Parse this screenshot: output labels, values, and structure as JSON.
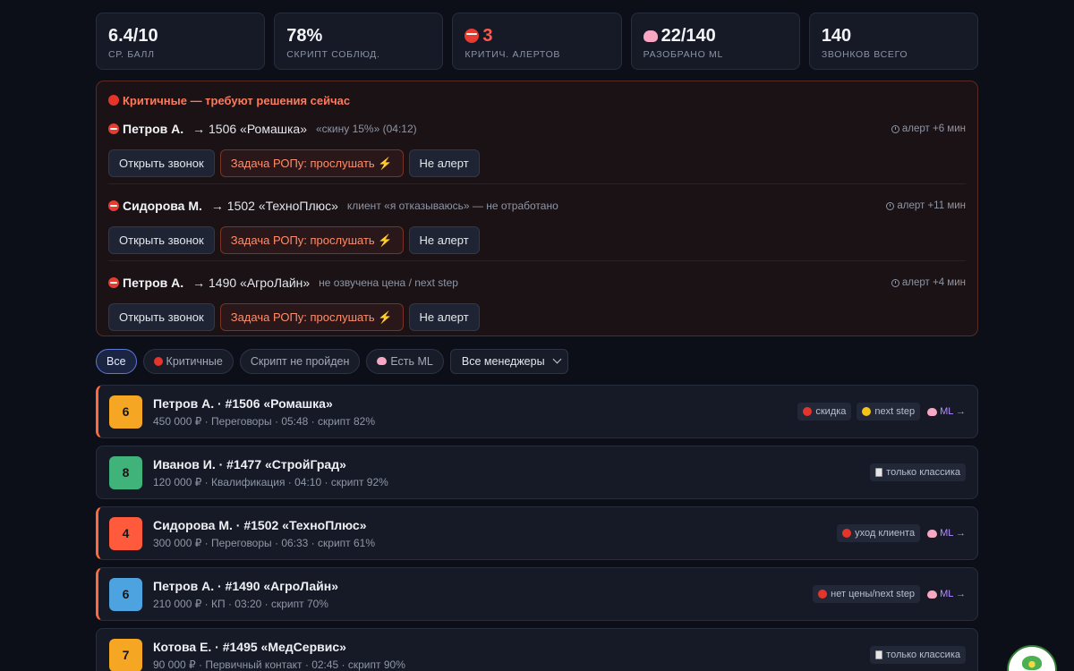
{
  "stats": [
    {
      "value": "6.4/10",
      "label": "Ср. балл",
      "icon": null,
      "color": null
    },
    {
      "value": "78%",
      "label": "Скрипт соблюд.",
      "icon": null,
      "color": null
    },
    {
      "value": "3",
      "label": "Критич. алертов",
      "icon": "no-entry-icon",
      "color": "#ff5a4e"
    },
    {
      "value": "22/140",
      "label": "Разобрано ML",
      "icon": "brain-icon",
      "color": null
    },
    {
      "value": "140",
      "label": "Звонков всего",
      "icon": null,
      "color": null
    }
  ],
  "critical": {
    "title": "Критичные — требуют решения сейчас",
    "alerts": [
      {
        "manager": "Петров А.",
        "deal": "→ 1506 «Ромашка»",
        "note": "«скину 15%» (04:12)",
        "time": "алерт +6 мин"
      },
      {
        "manager": "Сидорова М.",
        "deal": "→ 1502 «ТехноПлюс»",
        "note": "клиент «я отказываюсь» — не отработано",
        "time": "алерт +11 мин"
      },
      {
        "manager": "Петров А.",
        "deal": "→ 1490 «АгроЛайн»",
        "note": "не озвучена цена / next step",
        "time": "алерт +4 мин"
      }
    ],
    "buttons": {
      "open": "Открыть звонок",
      "task": "Задача РОПу: прослушать ⚡",
      "dismiss": "Не алерт"
    }
  },
  "filters": {
    "all": "Все",
    "critical": "Критичные",
    "script_failed": "Скрипт не пройден",
    "has_ml": "Есть ML",
    "managers_select": "Все менеджеры"
  },
  "calls": [
    {
      "score": "6",
      "score_color": "#f5a623",
      "title": "Петров А. · #1506 «Ромашка»",
      "sub": "450 000 ₽ · Переговоры · 05:48 · скрипт 82%",
      "hot": true,
      "tags": [
        {
          "icon": "red",
          "text": "скидка"
        },
        {
          "icon": "yellow",
          "text": "next step"
        }
      ],
      "ml": "ML →"
    },
    {
      "score": "8",
      "score_color": "#3fb37a",
      "title": "Иванов И. · #1477 «СтройГрад»",
      "sub": "120 000 ₽ · Квалификация · 04:10 · скрипт 92%",
      "hot": false,
      "tags": [
        {
          "icon": "clip",
          "text": "только классика"
        }
      ],
      "ml": ""
    },
    {
      "score": "4",
      "score_color": "#ff5a3c",
      "title": "Сидорова М. · #1502 «ТехноПлюс»",
      "sub": "300 000 ₽ · Переговоры · 06:33 · скрипт 61%",
      "hot": true,
      "tags": [
        {
          "icon": "red",
          "text": "уход клиента"
        }
      ],
      "ml": "ML →"
    },
    {
      "score": "6",
      "score_color": "#4da3e0",
      "title": "Петров А. · #1490 «АгроЛайн»",
      "sub": "210 000 ₽ · КП · 03:20 · скрипт 70%",
      "hot": true,
      "tags": [
        {
          "icon": "red",
          "text": "нет цены/next step"
        }
      ],
      "ml": "ML →"
    },
    {
      "score": "7",
      "score_color": "#f5a623",
      "title": "Котова Е. · #1495 «МедСервис»",
      "sub": "90 000 ₽ · Первичный контакт · 02:45 · скрипт 90%",
      "hot": false,
      "tags": [
        {
          "icon": "clip",
          "text": "только классика"
        }
      ],
      "ml": ""
    }
  ]
}
